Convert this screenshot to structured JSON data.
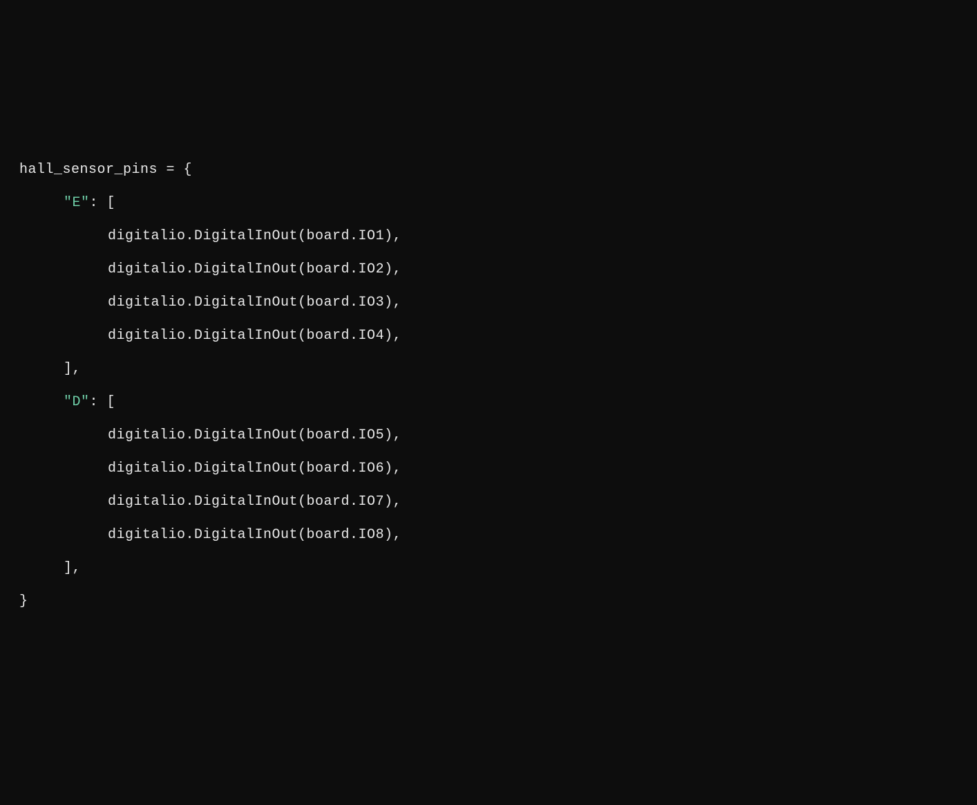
{
  "code": {
    "line0": "hall_sensor_pins = {",
    "key_e": "\"E\"",
    "after_key_e": ": [",
    "e0": "digitalio.DigitalInOut(board.IO",
    "e0n": "1",
    "e0end": "),",
    "e1": "digitalio.DigitalInOut(board.IO",
    "e1n": "2",
    "e1end": "),",
    "e2": "digitalio.DigitalInOut(board.IO",
    "e2n": "3",
    "e2end": "),",
    "e3": "digitalio.DigitalInOut(board.IO",
    "e3n": "4",
    "e3end": "),",
    "close_e": "],",
    "key_d": "\"D\"",
    "after_key_d": ": [",
    "d0": "digitalio.DigitalInOut(board.IO",
    "d0n": "5",
    "d0end": "),",
    "d1": "digitalio.DigitalInOut(board.IO",
    "d1n": "6",
    "d1end": "),",
    "d2": "digitalio.DigitalInOut(board.IO",
    "d2n": "7",
    "d2end": "),",
    "d3": "digitalio.DigitalInOut(board.IO",
    "d3n": "8",
    "d3end": "),",
    "close_d": "],",
    "close_dict": "}"
  }
}
